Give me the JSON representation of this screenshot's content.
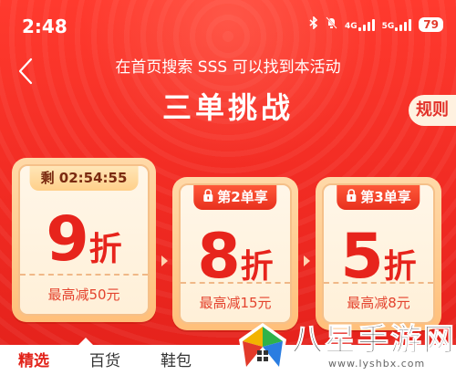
{
  "status_bar": {
    "time": "2:48",
    "net1": "4G",
    "net2": "5G",
    "battery": "79"
  },
  "header": {
    "subtitle": "在首页搜索 SSS 可以找到本活动",
    "title": "三单挑战",
    "rules_label": "规则"
  },
  "cards": [
    {
      "tag": "剩 02:54:55",
      "discount_num": "9",
      "discount_unit": "折",
      "footer": "最高减50元",
      "locked": false
    },
    {
      "tag": "第2单享",
      "discount_num": "8",
      "discount_unit": "折",
      "footer": "最高减15元",
      "locked": true
    },
    {
      "tag": "第3单享",
      "discount_num": "5",
      "discount_unit": "折",
      "footer": "最高减8元",
      "locked": true
    }
  ],
  "tabs": [
    {
      "label": "精选",
      "active": true
    },
    {
      "label": "百货",
      "active": false
    },
    {
      "label": "鞋包",
      "active": false
    }
  ],
  "watermark": {
    "name": "八星手游网",
    "url": "www.lyshbx.com"
  },
  "colors": {
    "brand_red": "#e8231f",
    "discount_red": "#e7241c",
    "card_gold": "#ffbf7a"
  }
}
